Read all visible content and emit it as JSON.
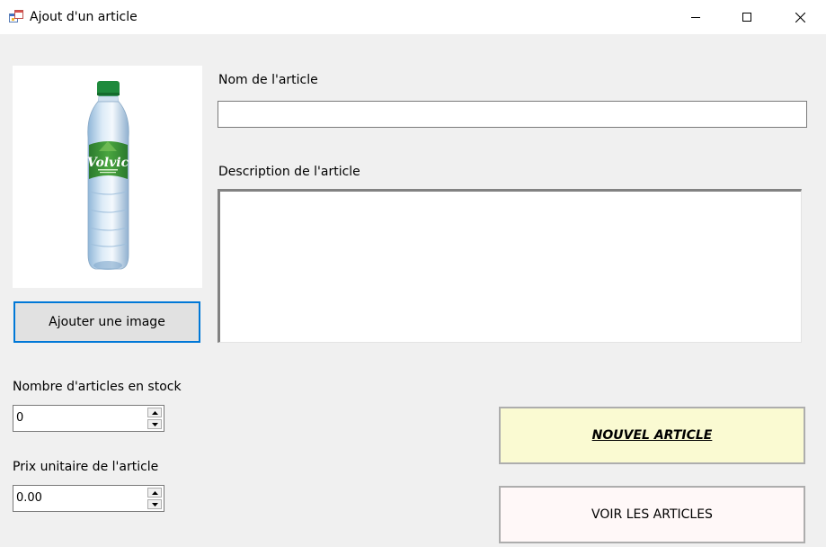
{
  "window": {
    "title": "Ajout d'un article",
    "icon": "app-form-icon",
    "controls": [
      "minimize-icon",
      "maximize-icon",
      "close-icon"
    ]
  },
  "image": {
    "description_icon": "product-image-water-bottle",
    "brand_text": "Volvic",
    "button_label": "Ajouter une image"
  },
  "form": {
    "name_label": "Nom de l'article",
    "name_value": "",
    "description_label": "Description de l'article",
    "description_value": "",
    "stock_label": "Nombre d'articles en stock",
    "stock_value": "0",
    "price_label": "Prix unitaire de l'article",
    "price_value": "0.00"
  },
  "actions": {
    "new_article_label": "NOUVEL ARTICLE",
    "view_articles_label": "VOIR LES ARTICLES"
  },
  "colors": {
    "window_bg": "#f0f0f0",
    "accent": "#0078d7",
    "new_button_bg": "#fafad2",
    "bottle_cap": "#1e8a3c"
  }
}
